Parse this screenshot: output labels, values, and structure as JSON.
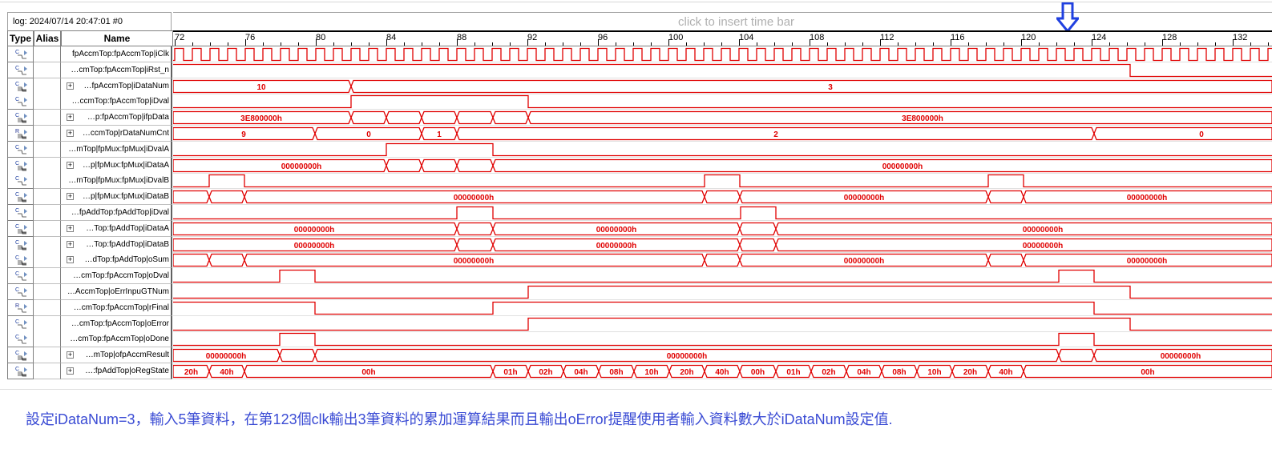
{
  "log_label": "log: 2024/07/14 20:47:01  #0",
  "time_bar_hint": "click to insert time bar",
  "columns": {
    "type": "Type",
    "alias": "Alias",
    "name": "Name"
  },
  "ruler": {
    "labels": [
      "72",
      "76",
      "80",
      "84",
      "88",
      "92",
      "96",
      "100",
      "104",
      "108",
      "112",
      "116",
      "120",
      "124",
      "128",
      "132"
    ]
  },
  "signals": [
    {
      "name": "fpAccmTop:fpAccmTop|iClk",
      "kind": "clock",
      "expandable": false,
      "reg": false
    },
    {
      "name": "…cmTop:fpAccmTop|iRst_n",
      "kind": "bit",
      "expandable": false,
      "reg": false
    },
    {
      "name": "…fpAccmTop|iDataNum",
      "kind": "bus",
      "expandable": true,
      "reg": false,
      "values": [
        "10",
        "3"
      ]
    },
    {
      "name": "…ccmTop:fpAccmTop|iDval",
      "kind": "bit",
      "expandable": false,
      "reg": false
    },
    {
      "name": "…p:fpAccmTop|ifpData",
      "kind": "bus",
      "expandable": true,
      "reg": false,
      "values": [
        "3E800000h",
        "3E800000h"
      ]
    },
    {
      "name": "…ccmTop|rDataNumCnt",
      "kind": "bus",
      "expandable": true,
      "reg": true,
      "values": [
        "9",
        "0",
        "1",
        "2",
        "0"
      ]
    },
    {
      "name": "…mTop|fpMux:fpMux|iDvalA",
      "kind": "bit",
      "expandable": false,
      "reg": false
    },
    {
      "name": "…p|fpMux:fpMux|iDataA",
      "kind": "bus",
      "expandable": true,
      "reg": false,
      "values": [
        "00000000h",
        "00000000h"
      ]
    },
    {
      "name": "…mTop|fpMux:fpMux|iDvalB",
      "kind": "bit",
      "expandable": false,
      "reg": false
    },
    {
      "name": "…p|fpMux:fpMux|iDataB",
      "kind": "bus",
      "expandable": true,
      "reg": false,
      "values": [
        "00000000h",
        "00000000h",
        "00000000h"
      ]
    },
    {
      "name": "…fpAddTop:fpAddTop|iDval",
      "kind": "bit",
      "expandable": false,
      "reg": false
    },
    {
      "name": "…Top:fpAddTop|iDataA",
      "kind": "bus",
      "expandable": true,
      "reg": false,
      "values": [
        "00000000h",
        "00000000h",
        "00000000h"
      ]
    },
    {
      "name": "…Top:fpAddTop|iDataB",
      "kind": "bus",
      "expandable": true,
      "reg": false,
      "values": [
        "00000000h",
        "00000000h",
        "00000000h"
      ]
    },
    {
      "name": "…dTop:fpAddTop|oSum",
      "kind": "bus",
      "expandable": true,
      "reg": false,
      "values": [
        "00000000h",
        "00000000h",
        "00000000h"
      ]
    },
    {
      "name": "…cmTop:fpAccmTop|oDval",
      "kind": "bit",
      "expandable": false,
      "reg": false
    },
    {
      "name": "…AccmTop|oErrInpuGTNum",
      "kind": "bit",
      "expandable": false,
      "reg": false
    },
    {
      "name": "…cmTop:fpAccmTop|rFinal",
      "kind": "bit",
      "expandable": false,
      "reg": true
    },
    {
      "name": "…cmTop:fpAccmTop|oError",
      "kind": "bit",
      "expandable": false,
      "reg": false
    },
    {
      "name": "…cmTop:fpAccmTop|oDone",
      "kind": "bit",
      "expandable": false,
      "reg": false
    },
    {
      "name": "…mTop|ofpAccmResult",
      "kind": "bus",
      "expandable": true,
      "reg": false,
      "values": [
        "00000000h",
        "00000000h",
        "00000000h"
      ]
    },
    {
      "name": "…:fpAddTop|oRegState",
      "kind": "bus",
      "expandable": true,
      "reg": false,
      "values": [
        "20h",
        "40h",
        "00h",
        "01h",
        "02h",
        "04h",
        "08h",
        "10h",
        "20h",
        "40h",
        "00h",
        "01h",
        "02h",
        "04h",
        "08h",
        "10h",
        "20h",
        "40h",
        "00h"
      ]
    }
  ],
  "caption": "設定iDataNum=3，輸入5筆資料，在第123個clk輸出3筆資料的累加運算結果而且輸出oError提醒使用者輸入資料數大於iDataNum設定值.",
  "colors": {
    "wave": "#e00000",
    "marker": "#2040e0",
    "caption": "#3a4bd4"
  }
}
